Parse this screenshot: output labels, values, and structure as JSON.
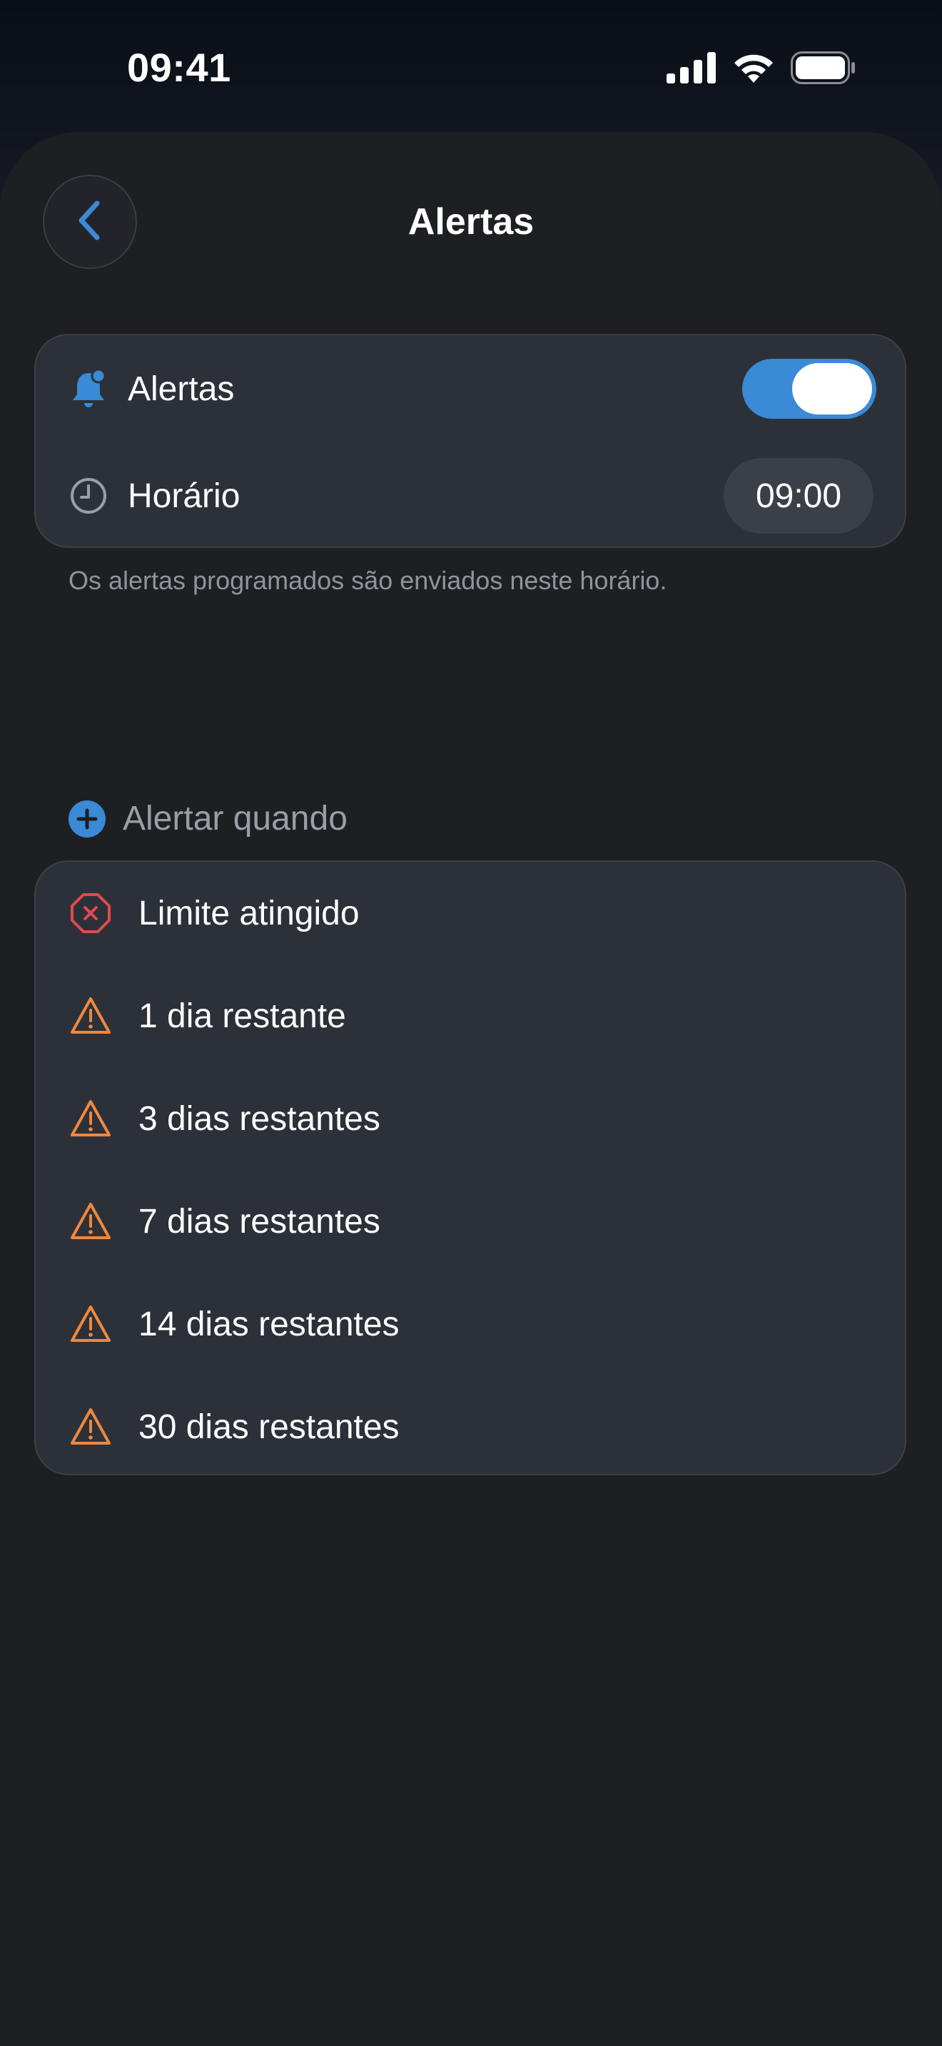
{
  "status_bar": {
    "time": "09:41",
    "icons": [
      "cellular-signal-icon",
      "wifi-icon",
      "battery-icon"
    ]
  },
  "nav": {
    "title": "Alertas",
    "back_icon": "chevron-left-icon"
  },
  "settings": {
    "alerts_row": {
      "icon": "bell-badge-icon",
      "label": "Alertas",
      "toggle_on": true
    },
    "time_row": {
      "icon": "clock-icon",
      "label": "Horário",
      "value": "09:00"
    },
    "footnote": "Os alertas programados são enviados neste horário."
  },
  "alert_when": {
    "icon": "plus-circle-icon",
    "label": "Alertar quando",
    "items": [
      {
        "label": "Limite atingido",
        "icon": "xmark-octagon-icon",
        "color": "#e5484d"
      },
      {
        "label": "1 dia restante",
        "icon": "warning-triangle-icon",
        "color": "#f0883e"
      },
      {
        "label": "3 dias restantes",
        "icon": "warning-triangle-icon",
        "color": "#f0883e"
      },
      {
        "label": "7 dias restantes",
        "icon": "warning-triangle-icon",
        "color": "#f0883e"
      },
      {
        "label": "14 dias restantes",
        "icon": "warning-triangle-icon",
        "color": "#f0883e"
      },
      {
        "label": "30 dias restantes",
        "icon": "warning-triangle-icon",
        "color": "#f0883e"
      }
    ]
  },
  "colors": {
    "accent": "#3a8ad6",
    "error": "#e5484d",
    "warning": "#f0883e",
    "background": "#1e1f23",
    "card": "#2c3139"
  }
}
